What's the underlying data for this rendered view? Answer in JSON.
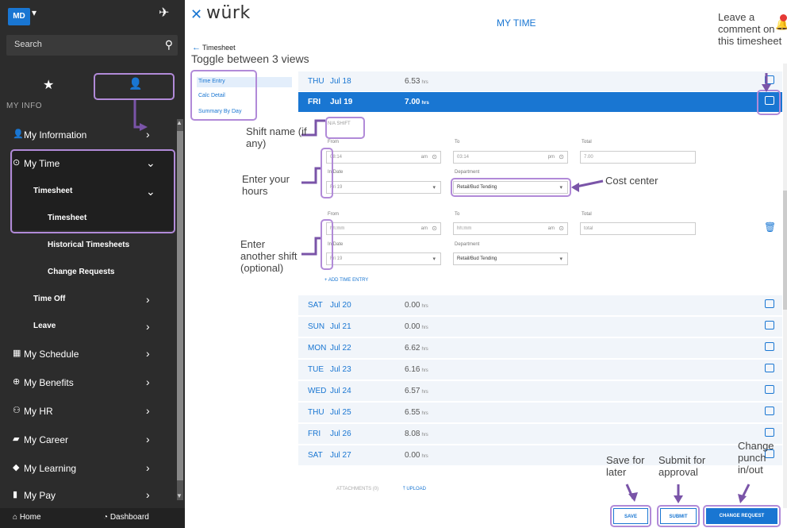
{
  "sidebar": {
    "avatar": "MD",
    "search_placeholder": "Search",
    "section": "MY INFO",
    "items": [
      {
        "label": "My Information"
      },
      {
        "label": "My Time"
      },
      {
        "label": "Timesheet"
      },
      {
        "label": "Timesheet"
      },
      {
        "label": "Historical Timesheets"
      },
      {
        "label": "Change Requests"
      },
      {
        "label": "Time Off"
      },
      {
        "label": "Leave"
      },
      {
        "label": "My Schedule"
      },
      {
        "label": "My Benefits"
      },
      {
        "label": "My HR"
      },
      {
        "label": "My Career"
      },
      {
        "label": "My Learning"
      },
      {
        "label": "My Pay"
      }
    ],
    "bottom": {
      "home": "Home",
      "dashboard": "Dashboard"
    }
  },
  "header": {
    "logo": "würk",
    "title": "MY TIME",
    "back_label": "Timesheet"
  },
  "views": [
    "Time Entry",
    "Calc Detail",
    "Summary By Day"
  ],
  "days": [
    {
      "dow": "THU",
      "date": "Jul 18",
      "hours": "6.53",
      "unit": "hrs"
    },
    {
      "dow": "FRI",
      "date": "Jul 19",
      "hours": "7.00",
      "unit": "hrs"
    },
    {
      "dow": "SAT",
      "date": "Jul 20",
      "hours": "0.00",
      "unit": "hrs"
    },
    {
      "dow": "SUN",
      "date": "Jul 21",
      "hours": "0.00",
      "unit": "hrs"
    },
    {
      "dow": "MON",
      "date": "Jul 22",
      "hours": "6.62",
      "unit": "hrs"
    },
    {
      "dow": "TUE",
      "date": "Jul 23",
      "hours": "6.16",
      "unit": "hrs"
    },
    {
      "dow": "WED",
      "date": "Jul 24",
      "hours": "6.57",
      "unit": "hrs"
    },
    {
      "dow": "THU",
      "date": "Jul 25",
      "hours": "6.55",
      "unit": "hrs"
    },
    {
      "dow": "FRI",
      "date": "Jul 26",
      "hours": "8.08",
      "unit": "hrs"
    },
    {
      "dow": "SAT",
      "date": "Jul 27",
      "hours": "0.00",
      "unit": "hrs"
    }
  ],
  "shift": {
    "name": "N/A SHIFT",
    "labels": {
      "from": "From",
      "to": "To",
      "total": "Total",
      "in_date": "In Date",
      "department": "Department"
    },
    "entry1": {
      "from": "08:14",
      "from_suffix": "am",
      "to": "03:14",
      "to_suffix": "pm",
      "total": "7.00",
      "in_date": "Fri 19",
      "department": "Retail/Bud Tending"
    },
    "entry2": {
      "from": "hh:mm",
      "from_suffix": "am",
      "to": "hh:mm",
      "to_suffix": "am",
      "total": "total",
      "in_date": "Fri 19",
      "department": "Retail/Bud Tending"
    },
    "add_entry": "+ ADD TIME ENTRY",
    "attachments": "ATTACHMENTS (0)",
    "upload": "UPLOAD"
  },
  "actions": {
    "save": "SAVE",
    "submit": "SUBMIT",
    "change_request": "CHANGE REQUEST"
  },
  "annotations": {
    "toggle_views": "Toggle between 3 views",
    "leave_comment": "Leave a comment on this timesheet",
    "shift_name": "Shift name (if any)",
    "enter_hours": "Enter your hours",
    "cost_center": "Cost center",
    "another_shift": "Enter another shift (optional)",
    "save_later": "Save for later",
    "submit_approval": "Submit for approval",
    "change_punch": "Change punch in/out"
  },
  "colors": {
    "accent": "#1976d2",
    "sidebar": "#2c2c2c",
    "annotation": "#b18ad8"
  }
}
